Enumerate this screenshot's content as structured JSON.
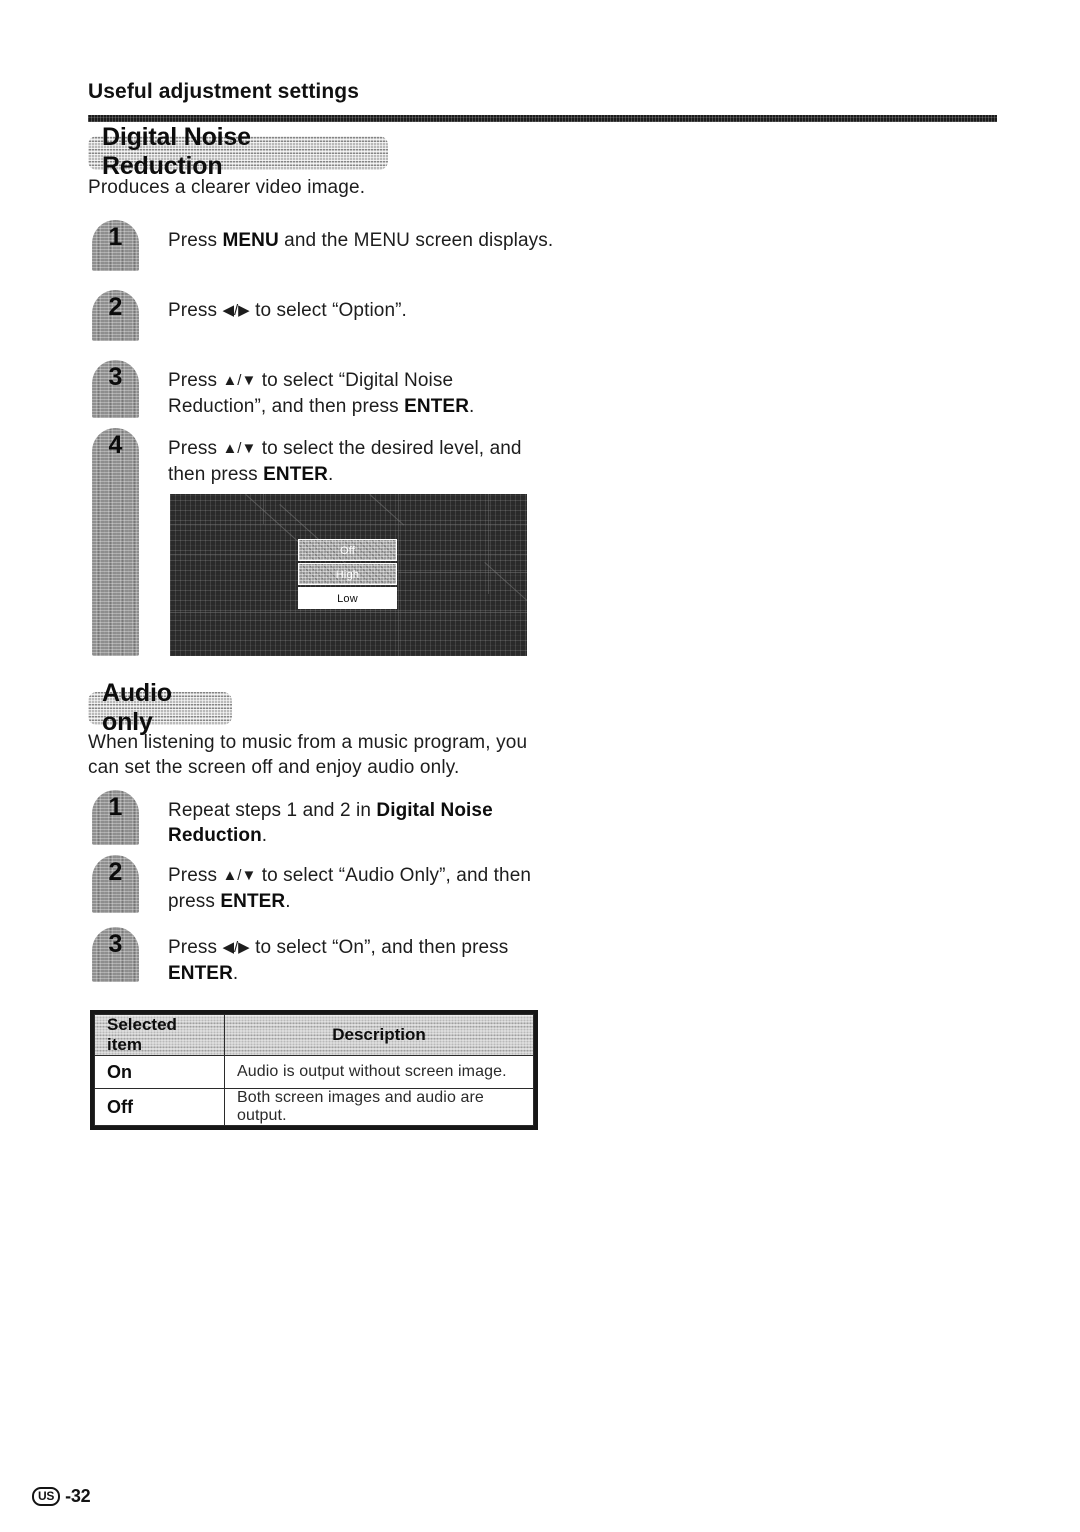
{
  "page": {
    "heading": "Useful adjustment settings",
    "footer_region": "US",
    "footer_page": "-32"
  },
  "sections": [
    {
      "title": "Digital Noise Reduction",
      "intro": "Produces a clearer video image.",
      "steps": [
        {
          "number": "1",
          "html": "Press <b>MENU</b> and the MENU screen displays.",
          "text": "Press MENU and the MENU screen displays."
        },
        {
          "number": "2",
          "html": "Press <span class=\"arrows\">◀/▶</span> to select “Option”.",
          "text": "Press ◀/▶ to select “Option”."
        },
        {
          "number": "3",
          "html": "<span class=\"just\">Press <span class=\"arrows\">▲/▼</span> to select “Digital Noise</span>Reduction”, and then press <b>ENTER</b>.",
          "text": "Press ▲/▼ to select “Digital Noise Reduction”, and then press ENTER."
        },
        {
          "number": "4",
          "html": "Press <span class=\"arrows\">▲/▼</span> to select the desired level, and<br>then press <b>ENTER</b>.",
          "text": "Press ▲/▼ to select the desired level, and then press ENTER."
        }
      ]
    },
    {
      "title": "Audio only",
      "intro": "When listening to music from a music program, you can set the screen off and enjoy audio only.",
      "steps": [
        {
          "number": "1",
          "html": "<span class=\"just\">Repeat steps 1 and 2 in <b>Digital Noise</b></span><b>Reduction</b>.",
          "text": "Repeat steps 1 and 2 in Digital Noise Reduction."
        },
        {
          "number": "2",
          "html": "Press <span class=\"arrows\">▲/▼</span> to select “Audio Only”, and then<br>press <b>ENTER</b>.",
          "text": "Press ▲/▼ to select “Audio Only”, and then press ENTER."
        },
        {
          "number": "3",
          "html": "<span class=\"just\">Press <span class=\"arrows\">◀/▶</span> to select “On”, and then press</span><b>ENTER</b>.",
          "text": "Press ◀/▶ to select “On”, and then press ENTER."
        }
      ]
    }
  ],
  "tv_screenshot": {
    "menu_items": [
      {
        "label": "Off",
        "state": "normal"
      },
      {
        "label": "High",
        "state": "normal"
      },
      {
        "label": "Low",
        "state": "selected"
      }
    ]
  },
  "table": {
    "headers": [
      "Selected item",
      "Description"
    ],
    "rows": [
      {
        "item": "On",
        "desc": "Audio is output without screen image."
      },
      {
        "item": "Off",
        "desc": "Both screen images and audio are output."
      }
    ]
  }
}
